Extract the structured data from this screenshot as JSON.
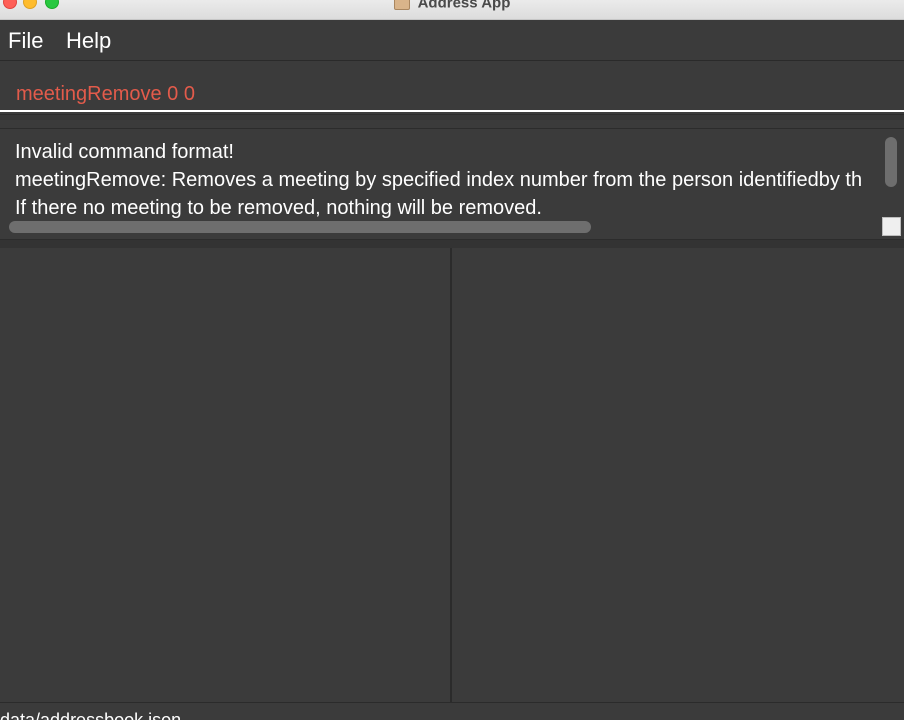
{
  "window": {
    "title": "Address App"
  },
  "menu": {
    "file": "File",
    "help": "Help"
  },
  "command_box": {
    "value": "meetingRemove 0 0"
  },
  "result": {
    "lines": [
      "Invalid command format!",
      "meetingRemove: Removes a meeting by specified index number from the person identifiedby th",
      "If there no meeting to be removed, nothing will be removed."
    ]
  },
  "status_bar": {
    "path": "data/addressbook.json"
  },
  "colors": {
    "background": "#3b3b3b",
    "command_text": "#e35b4b",
    "text": "#ffffff"
  }
}
